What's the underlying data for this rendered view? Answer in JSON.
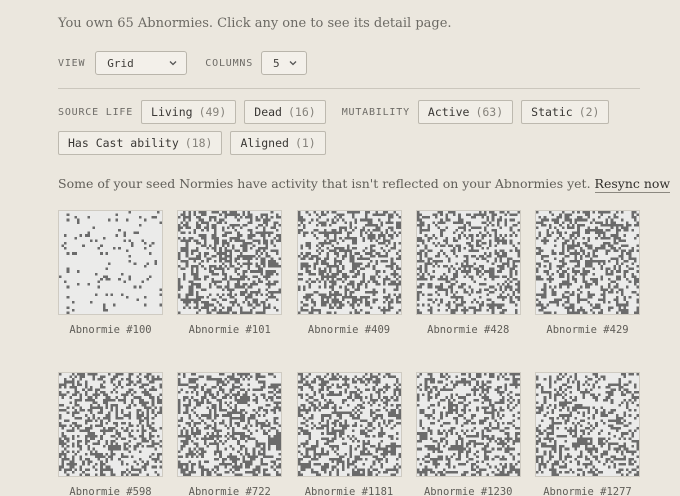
{
  "intro": "You own 65 Abnormies. Click any one to see its detail page.",
  "controls": {
    "view_label": "VIEW",
    "view_value": "Grid",
    "columns_label": "COLUMNS",
    "columns_value": "5"
  },
  "filters": {
    "source_life_label": "SOURCE LIFE",
    "living": {
      "label": "Living",
      "count": "(49)"
    },
    "dead": {
      "label": "Dead",
      "count": "(16)"
    },
    "mutability_label": "MUTABILITY",
    "active": {
      "label": "Active",
      "count": "(63)"
    },
    "static": {
      "label": "Static",
      "count": "(2)"
    },
    "cast": {
      "label": "Has Cast ability",
      "count": "(18)"
    },
    "aligned": {
      "label": "Aligned",
      "count": "(1)"
    }
  },
  "notice": {
    "text": "Some of your seed Normies have activity that isn't reflected on your Abnormies yet.",
    "action": "Resync now"
  },
  "colors": {
    "background": "#ebe7de",
    "pixel_dark": "#6b6b6b",
    "pixel_light": "#ebebea"
  },
  "abnormies": [
    {
      "name": "Abnormie #100",
      "density": 0.07
    },
    {
      "name": "Abnormie #101",
      "density": 0.42
    },
    {
      "name": "Abnormie #409",
      "density": 0.4
    },
    {
      "name": "Abnormie #428",
      "density": 0.38
    },
    {
      "name": "Abnormie #429",
      "density": 0.4
    },
    {
      "name": "Abnormie #598",
      "density": 0.41
    },
    {
      "name": "Abnormie #722",
      "density": 0.43
    },
    {
      "name": "Abnormie #1181",
      "density": 0.4
    },
    {
      "name": "Abnormie #1230",
      "density": 0.41
    },
    {
      "name": "Abnormie #1277",
      "density": 0.38
    }
  ]
}
